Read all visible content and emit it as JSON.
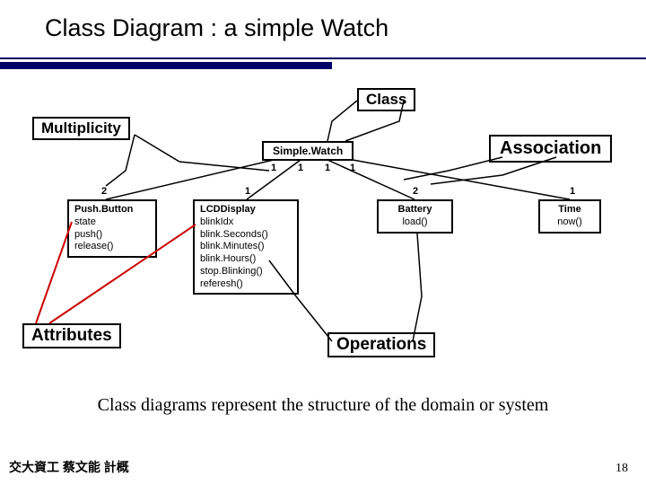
{
  "title": "Class Diagram  :  a simple Watch",
  "labels": {
    "class": "Class",
    "multiplicity": "Multiplicity",
    "association": "Association",
    "attributes": "Attributes",
    "operations": "Operations"
  },
  "top_class": {
    "name": "Simple.Watch"
  },
  "mult": {
    "sw_a": "1",
    "sw_b": "1",
    "sw_c": "1",
    "sw_d": "1",
    "pb": "2",
    "lcd": "1",
    "bat": "2",
    "time": "1"
  },
  "classes": {
    "pushbutton": {
      "name": "Push.Button",
      "lines": [
        "state",
        "push()",
        "release()"
      ]
    },
    "lcd": {
      "name": "LCDDisplay",
      "lines": [
        "blinkIdx",
        "blink.Seconds()",
        "blink.Minutes()",
        "blink.Hours()",
        "stop.Blinking()",
        "referesh()"
      ]
    },
    "battery": {
      "name": "Battery",
      "lines": [
        "load()"
      ]
    },
    "time": {
      "name": "Time",
      "lines": [
        "now()"
      ]
    }
  },
  "caption": "Class diagrams represent the structure of the domain or system",
  "footer": "交大資工 蔡文能 計概",
  "page": "18"
}
